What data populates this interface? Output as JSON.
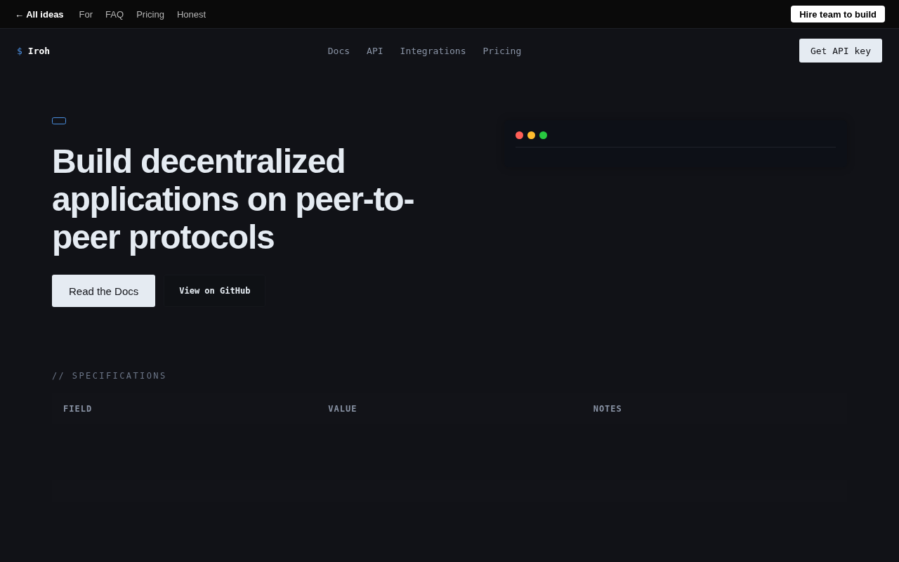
{
  "top_bar": {
    "back_link": "← All ideas",
    "links": [
      "For",
      "FAQ",
      "Pricing",
      "Honest"
    ],
    "cta": "Hire team to build"
  },
  "nav": {
    "logo_symbol": "$",
    "logo_name": "Iroh",
    "links": [
      "Docs",
      "API",
      "Integrations",
      "Pricing"
    ],
    "cta": "Get API key"
  },
  "hero": {
    "heading": "Build decentralized applications on peer-to-peer protocols",
    "buttons": [
      {
        "label": "Read the Docs",
        "kind": "primary"
      },
      {
        "label": "View on GitHub",
        "kind": "secondary"
      }
    ]
  },
  "terminal": {
    "dots": [
      {
        "color": "#ff5f57"
      },
      {
        "color": "#febc2e"
      },
      {
        "color": "#28c840"
      }
    ]
  },
  "specifications": {
    "label": "// SPECIFICATIONS",
    "columns": [
      "FIELD",
      "VALUE",
      "NOTES"
    ]
  }
}
